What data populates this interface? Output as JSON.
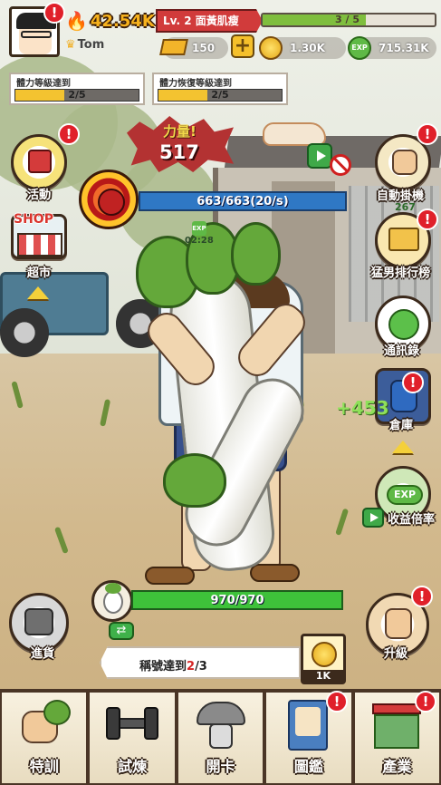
{
  "header": {
    "power_value": "42.54K",
    "username": "Tom",
    "level_label": "Lv. 2 面黃肌瘦",
    "level_progress": "3 / 5",
    "level_fraction": 0.6,
    "gold_bars": "150",
    "coins": "1.30K",
    "exp": "715.31K",
    "exp_icon": "EXP",
    "plus_symbol": "+"
  },
  "quests": [
    {
      "title": "體力等級達到",
      "progress": "2/5",
      "fraction": 0.4
    },
    {
      "title": "體力恢復等級達到",
      "progress": "2/5",
      "fraction": 0.4
    }
  ],
  "left_buttons": {
    "event": "活動",
    "shop_sign": "SHOP",
    "market": "超市"
  },
  "right_buttons": {
    "auto_idle": "自動掛機",
    "auto_idle_count": "267",
    "ranking": "猛男排行榜",
    "contacts": "通訊錄",
    "warehouse": "倉庫",
    "income_rate": "收益倍率",
    "exp_icon": "EXP"
  },
  "power_burst": {
    "title": "力量!",
    "value": "517"
  },
  "boss": {
    "hp": "663/663(20/s)",
    "timer_icon": "EXP",
    "timer": "02:28"
  },
  "float_gain": "+453",
  "vegetable": {
    "hp": "970/970",
    "swap_symbol": "⇄"
  },
  "bottom_left": {
    "advance": "進貨",
    "upgrade": "升級"
  },
  "title_task": {
    "prefix": "稱號達到",
    "current": "2",
    "total": "/3"
  },
  "reward": {
    "amount": "1K"
  },
  "alert_mark": "!",
  "nav": [
    {
      "label": "特訓",
      "icon": "radish-training-icon"
    },
    {
      "label": "試煉",
      "icon": "dumbbell-icon"
    },
    {
      "label": "開卡",
      "icon": "mushroom-icon"
    },
    {
      "label": "圖鑑",
      "icon": "encyclopedia-icon"
    },
    {
      "label": "產業",
      "icon": "building-icon"
    }
  ],
  "colors": {
    "power_text": "#f7b21d",
    "level_ribbon": "#d13b3b",
    "boss_bar": "#2f78c4",
    "veg_bar": "#3ec13a",
    "alert": "#e0202a"
  }
}
